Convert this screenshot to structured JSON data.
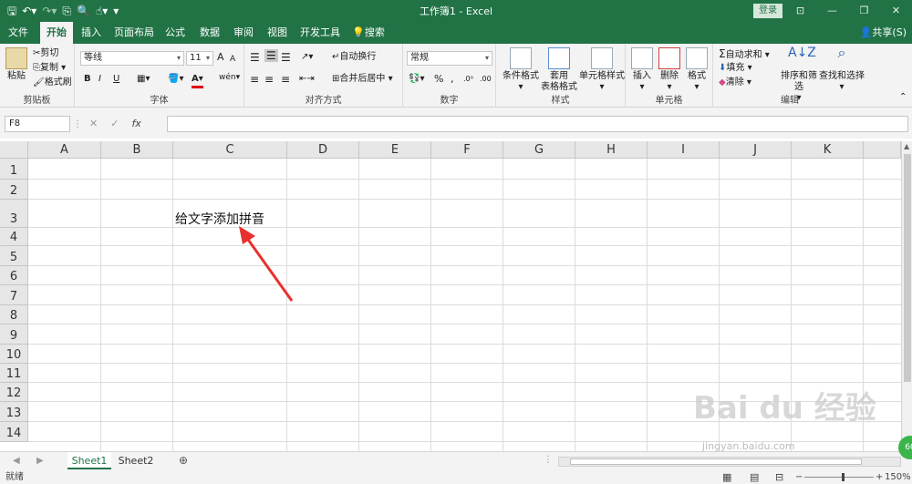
{
  "app": {
    "title": "工作簿1 - Excel",
    "login": "登录",
    "share": "共享(S)"
  },
  "tabs": [
    "文件",
    "开始",
    "插入",
    "页面布局",
    "公式",
    "数据",
    "审阅",
    "视图",
    "开发工具",
    "搜索"
  ],
  "ribbon": {
    "clipboard": {
      "paste": "粘贴",
      "cut": "剪切",
      "copy": "复制",
      "format_painter": "格式刷",
      "label": "剪贴板"
    },
    "font": {
      "name": "等线",
      "size": "11",
      "grow": "A",
      "shrink": "A",
      "bold": "B",
      "italic": "I",
      "underline": "U",
      "label": "字体"
    },
    "align": {
      "wrap": "自动换行",
      "merge": "合并后居中",
      "label": "对齐方式"
    },
    "number": {
      "format": "常规",
      "percent": "%",
      "comma": ",",
      "label": "数字"
    },
    "styles": {
      "conditional": "条件格式",
      "table1": "套用",
      "table2": "表格格式",
      "cell": "单元格样式",
      "label": "样式"
    },
    "cells": {
      "insert": "插入",
      "delete": "删除",
      "format": "格式",
      "label": "单元格"
    },
    "editing": {
      "autosum": "自动求和",
      "fill": "填充",
      "clear": "清除",
      "sort": "排序和筛选",
      "find": "查找和选择",
      "label": "编辑"
    }
  },
  "formula_bar": {
    "name_box": "F8",
    "fx": "fx",
    "cancel": "✕",
    "enter": "✓",
    "value": ""
  },
  "sheet": {
    "columns": [
      "A",
      "B",
      "C",
      "D",
      "E",
      "F",
      "G",
      "H",
      "I",
      "J",
      "K"
    ],
    "rows": [
      "1",
      "2",
      "3",
      "4",
      "5",
      "6",
      "7",
      "8",
      "9",
      "10",
      "11",
      "12",
      "13",
      "14"
    ],
    "cell_c3": "给文字添加拼音"
  },
  "sheet_tabs": [
    "Sheet1",
    "Sheet2"
  ],
  "status": {
    "ready": "就绪",
    "zoom": "150%"
  },
  "colors": {
    "accent": "#217346",
    "arrow": "#e8312f"
  },
  "watermark": {
    "text": "Bai du 经验",
    "url": "jingyan.baidu.com",
    "badge": "60"
  }
}
